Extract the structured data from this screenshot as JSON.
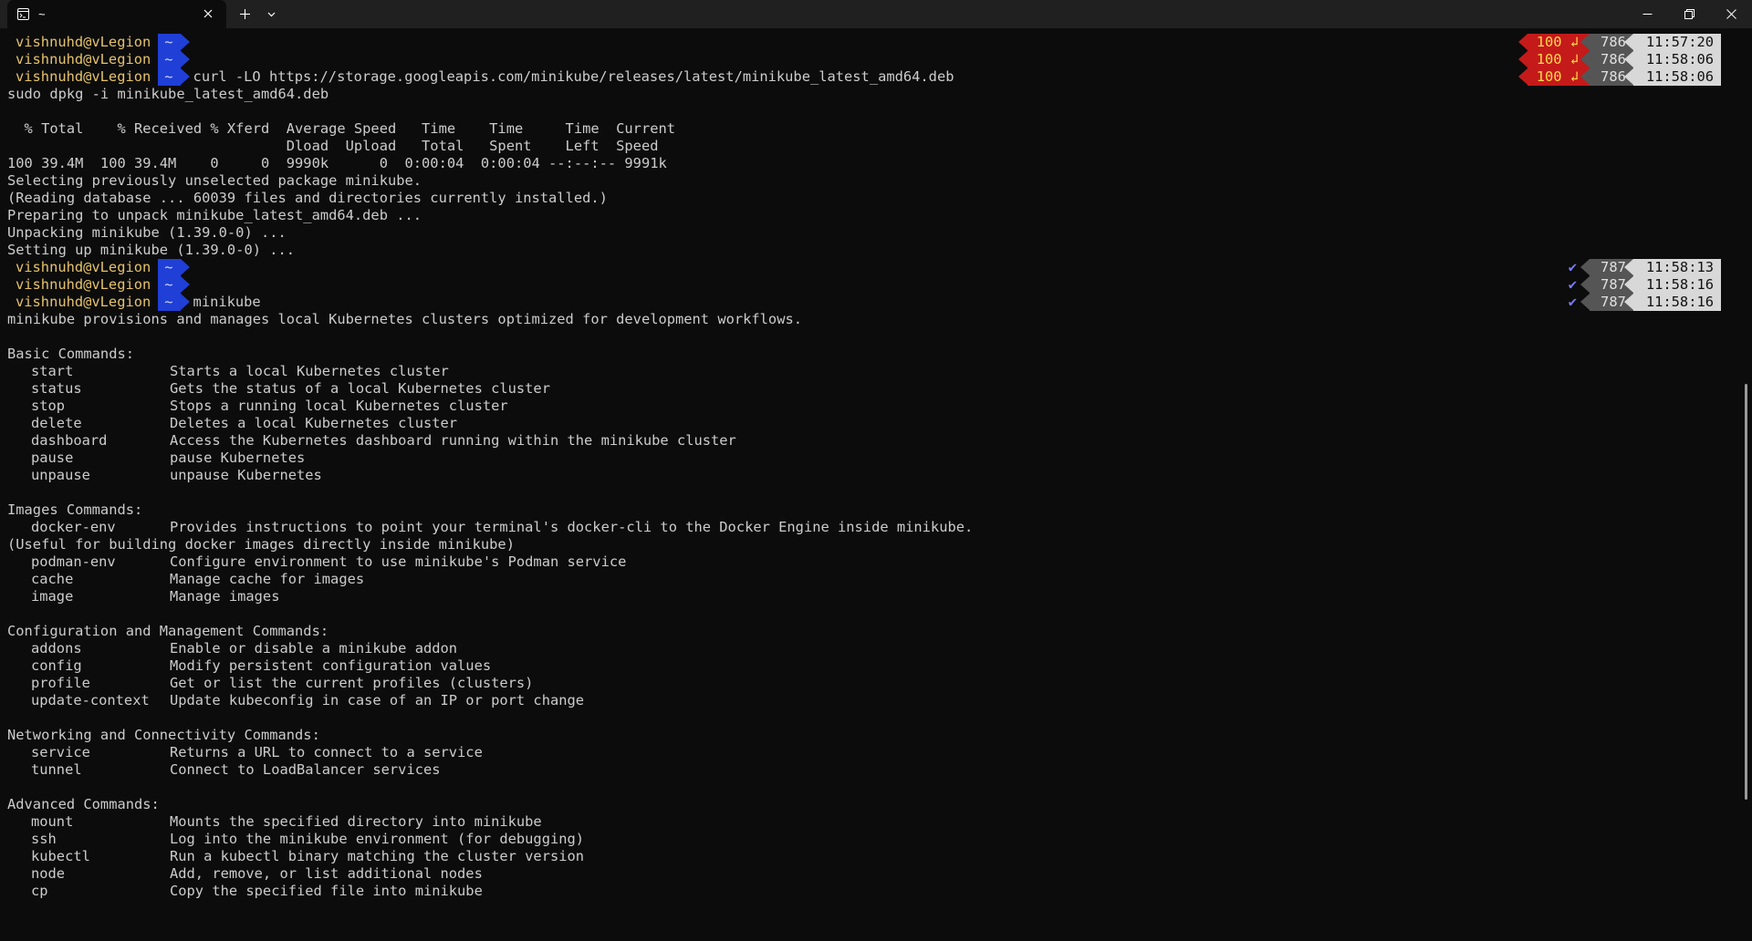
{
  "tab": {
    "title": "~"
  },
  "prompt": {
    "user": "vishnuhd@vLegion",
    "dir": "~"
  },
  "commands": {
    "curl": "curl -LO https://storage.googleapis.com/minikube/releases/latest/minikube_latest_amd64.deb",
    "minikube": "minikube"
  },
  "output": {
    "dpkg_cmd": "sudo dpkg -i minikube_latest_amd64.deb",
    "curl_hdr1": "  % Total    % Received % Xferd  Average Speed   Time    Time     Time  Current",
    "curl_hdr2": "                                 Dload  Upload   Total   Spent    Left  Speed",
    "curl_progress": "100 39.4M  100 39.4M    0     0  9990k      0  0:00:04  0:00:04 --:--:-- 9991k",
    "dpkg_lines": [
      "Selecting previously unselected package minikube.",
      "(Reading database ... 60039 files and directories currently installed.)",
      "Preparing to unpack minikube_latest_amd64.deb ...",
      "Unpacking minikube (1.39.0-0) ...",
      "Setting up minikube (1.39.0-0) ..."
    ],
    "intro": "minikube provisions and manages local Kubernetes clusters optimized for development workflows."
  },
  "help_sections": [
    {
      "title": "Basic Commands:",
      "items": [
        {
          "cmd": "start",
          "desc": "Starts a local Kubernetes cluster"
        },
        {
          "cmd": "status",
          "desc": "Gets the status of a local Kubernetes cluster"
        },
        {
          "cmd": "stop",
          "desc": "Stops a running local Kubernetes cluster"
        },
        {
          "cmd": "delete",
          "desc": "Deletes a local Kubernetes cluster"
        },
        {
          "cmd": "dashboard",
          "desc": "Access the Kubernetes dashboard running within the minikube cluster"
        },
        {
          "cmd": "pause",
          "desc": "pause Kubernetes"
        },
        {
          "cmd": "unpause",
          "desc": "unpause Kubernetes"
        }
      ]
    },
    {
      "title": "Images Commands:",
      "items": [
        {
          "cmd": "docker-env",
          "desc": "Provides instructions to point your terminal's docker-cli to the Docker Engine inside minikube."
        }
      ],
      "note": "(Useful for building docker images directly inside minikube)",
      "items2": [
        {
          "cmd": "podman-env",
          "desc": "Configure environment to use minikube's Podman service"
        },
        {
          "cmd": "cache",
          "desc": "Manage cache for images"
        },
        {
          "cmd": "image",
          "desc": "Manage images"
        }
      ]
    },
    {
      "title": "Configuration and Management Commands:",
      "items": [
        {
          "cmd": "addons",
          "desc": "Enable or disable a minikube addon"
        },
        {
          "cmd": "config",
          "desc": "Modify persistent configuration values"
        },
        {
          "cmd": "profile",
          "desc": "Get or list the current profiles (clusters)"
        },
        {
          "cmd": "update-context",
          "desc": "Update kubeconfig in case of an IP or port change"
        }
      ]
    },
    {
      "title": "Networking and Connectivity Commands:",
      "items": [
        {
          "cmd": "service",
          "desc": "Returns a URL to connect to a service"
        },
        {
          "cmd": "tunnel",
          "desc": "Connect to LoadBalancer services"
        }
      ]
    },
    {
      "title": "Advanced Commands:",
      "items": [
        {
          "cmd": "mount",
          "desc": "Mounts the specified directory into minikube"
        },
        {
          "cmd": "ssh",
          "desc": "Log into the minikube environment (for debugging)"
        },
        {
          "cmd": "kubectl",
          "desc": "Run a kubectl binary matching the cluster version"
        },
        {
          "cmd": "node",
          "desc": "Add, remove, or list additional nodes"
        },
        {
          "cmd": "cp",
          "desc": "Copy the specified file into minikube"
        }
      ]
    }
  ],
  "right_prompts": [
    {
      "status": "100 ↲",
      "count": "786",
      "time": "11:57:20"
    },
    {
      "status": "100 ↲",
      "count": "786",
      "time": "11:58:06"
    },
    {
      "status": "100 ↲",
      "count": "786",
      "time": "11:58:06"
    },
    {
      "status": "✔",
      "count": "787",
      "time": "11:58:13"
    },
    {
      "status": "✔",
      "count": "787",
      "time": "11:58:16"
    },
    {
      "status": "✔",
      "count": "787",
      "time": "11:58:16"
    }
  ],
  "colors": {
    "background": "#0c0c0c",
    "prompt_user": "#e5c26b",
    "prompt_dir_bg": "#1f3fd6",
    "error_bg": "#c41a1a",
    "ok_check": "#7a7cf0"
  }
}
